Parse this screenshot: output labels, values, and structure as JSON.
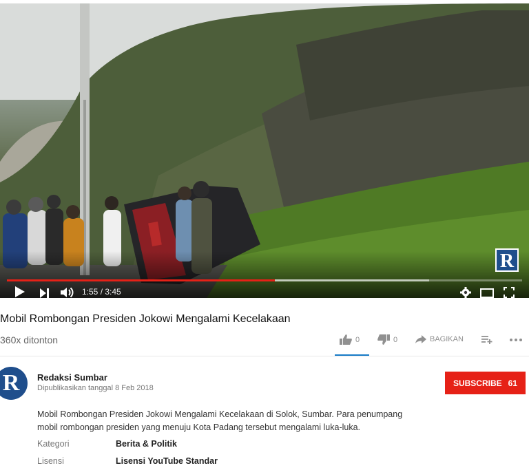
{
  "video": {
    "watermark": "R",
    "progress_fraction": 0.52,
    "buffer_fraction": 0.82,
    "time": "1:55 / 3:45",
    "accent_color": "#e62117"
  },
  "info": {
    "title": "Mobil Rombongan Presiden Jokowi Mengalami Kecelakaan",
    "views": "360x ditonton",
    "likes": "0",
    "dislikes": "0",
    "share_label": "BAGIKAN"
  },
  "channel": {
    "avatar_letter": "R",
    "name": "Redaksi Sumbar",
    "published": "Dipublikasikan tanggal 8 Feb 2018",
    "subscribe_label": "SUBSCRIBE",
    "subscriber_count": "61"
  },
  "description": {
    "line1": "Mobil Rombongan Presiden Jokowi Mengalami Kecelakaan di Solok, Sumbar. Para penumpang",
    "line2": "mobil rombongan presiden yang menuju Kota Padang tersebut mengalami luka-luka."
  },
  "meta": {
    "category_label": "Kategori",
    "category_value": "Berita & Politik",
    "license_label": "Lisensi",
    "license_value": "Lisensi YouTube Standar"
  },
  "icons": [
    "play-icon",
    "next-icon",
    "volume-icon",
    "settings-icon",
    "theater-icon",
    "fullscreen-icon",
    "like-icon",
    "dislike-icon",
    "share-icon",
    "add-to-playlist-icon",
    "more-icon"
  ]
}
